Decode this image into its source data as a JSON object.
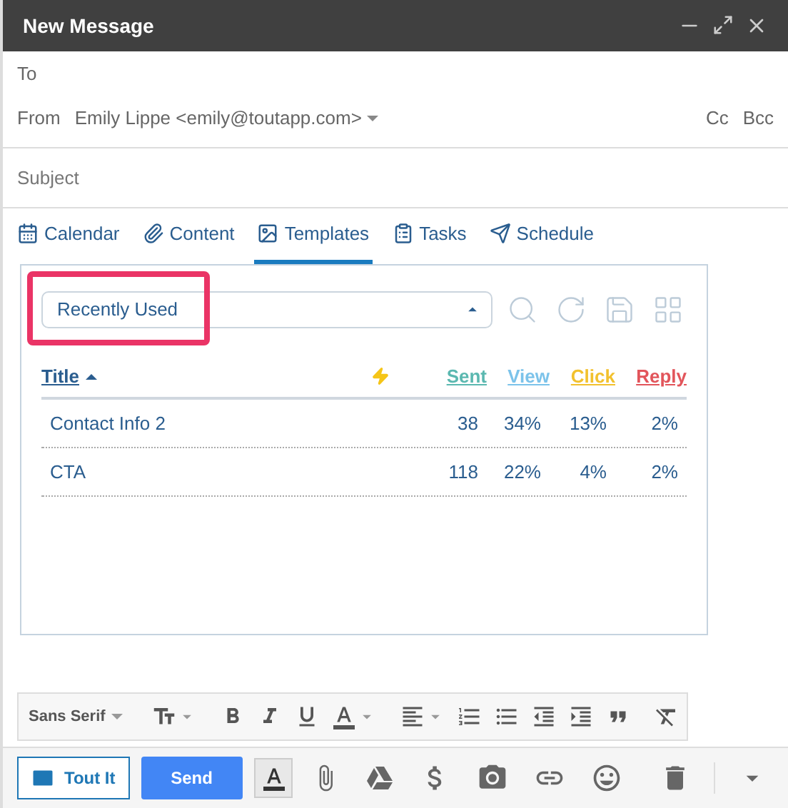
{
  "window": {
    "title": "New Message"
  },
  "fields": [
    {
      "label": "To"
    },
    {
      "label": "From",
      "value": "Emily Lippe <emily@toutapp.com>"
    }
  ],
  "cc": "Cc",
  "bcc": "Bcc",
  "subject": {
    "placeholder": "Subject"
  },
  "tabs": [
    {
      "kind": "calendar",
      "label": "Calendar",
      "selected": false
    },
    {
      "kind": "content",
      "label": "Content",
      "selected": false
    },
    {
      "kind": "templates",
      "label": "Templates",
      "selected": true
    },
    {
      "kind": "tasks",
      "label": "Tasks",
      "selected": false
    },
    {
      "kind": "schedule",
      "label": "Schedule",
      "selected": false
    }
  ],
  "panel": {
    "filter": "Recently Used",
    "highlighted": true,
    "title_column": "Title",
    "columns": [
      {
        "label": "Sent",
        "color": "#5bb8b0"
      },
      {
        "label": "View",
        "color": "#7cc3ea"
      },
      {
        "label": "Click",
        "color": "#f2c12e"
      },
      {
        "label": "Reply",
        "color": "#e2555b"
      }
    ],
    "rows": [
      {
        "title": "Contact Info 2",
        "cells": [
          "38",
          "34%",
          "13%",
          "2%"
        ]
      },
      {
        "title": "CTA",
        "cells": [
          "118",
          "22%",
          "4%",
          "2%"
        ]
      }
    ]
  },
  "format_bar": {
    "font": "Sans Serif"
  },
  "actions": {
    "tout": "Tout It",
    "send": "Send"
  }
}
